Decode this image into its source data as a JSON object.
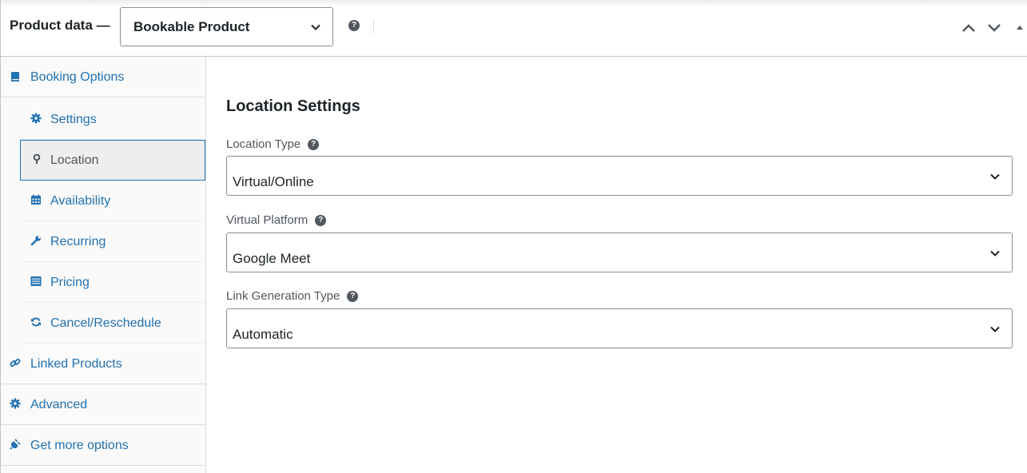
{
  "header": {
    "title": "Product data —",
    "product_type": "Bookable Product",
    "help_glyph": "?"
  },
  "sidebar": {
    "items": [
      {
        "label": "Booking Options",
        "icon": "book-icon"
      },
      {
        "label": "Settings",
        "icon": "gear-icon"
      },
      {
        "label": "Location",
        "icon": "map-pin-icon",
        "active": true
      },
      {
        "label": "Availability",
        "icon": "calendar-icon"
      },
      {
        "label": "Recurring",
        "icon": "wrench-icon"
      },
      {
        "label": "Pricing",
        "icon": "list-icon"
      },
      {
        "label": "Cancel/Reschedule",
        "icon": "refresh-icon"
      },
      {
        "label": "Linked Products",
        "icon": "link-icon"
      },
      {
        "label": "Advanced",
        "icon": "gear-icon"
      },
      {
        "label": "Get more options",
        "icon": "plugin-icon"
      }
    ]
  },
  "main": {
    "section_title": "Location Settings",
    "fields": [
      {
        "label": "Location Type",
        "value": "Virtual/Online"
      },
      {
        "label": "Virtual Platform",
        "value": "Google Meet"
      },
      {
        "label": "Link Generation Type",
        "value": "Automatic"
      }
    ]
  },
  "colors": {
    "link": "#2271b1",
    "border": "#c3c4c7",
    "active_bg": "#eeeeee"
  }
}
